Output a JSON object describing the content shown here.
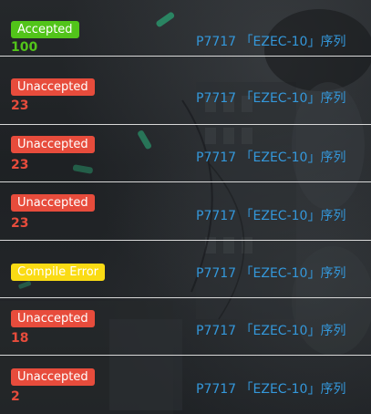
{
  "records": [
    {
      "status": "Accepted",
      "status_type": "ac",
      "score": "100",
      "problem": "P7717 「EZEC-10」序列"
    },
    {
      "status": "Unaccepted",
      "status_type": "wa",
      "score": "23",
      "problem": "P7717 「EZEC-10」序列"
    },
    {
      "status": "Unaccepted",
      "status_type": "wa",
      "score": "23",
      "problem": "P7717 「EZEC-10」序列"
    },
    {
      "status": "Unaccepted",
      "status_type": "wa",
      "score": "23",
      "problem": "P7717 「EZEC-10」序列"
    },
    {
      "status": "Compile Error",
      "status_type": "ce",
      "score": "",
      "problem": "P7717 「EZEC-10」序列"
    },
    {
      "status": "Unaccepted",
      "status_type": "wa",
      "score": "18",
      "problem": "P7717 「EZEC-10」序列"
    },
    {
      "status": "Unaccepted",
      "status_type": "wa",
      "score": "2",
      "problem": "P7717 「EZEC-10」序列"
    }
  ],
  "colors": {
    "accepted": "#52c41a",
    "unaccepted": "#e74c3c",
    "compile_error": "#fadb14",
    "link": "#3498db",
    "divider": "#d8d8d8"
  }
}
